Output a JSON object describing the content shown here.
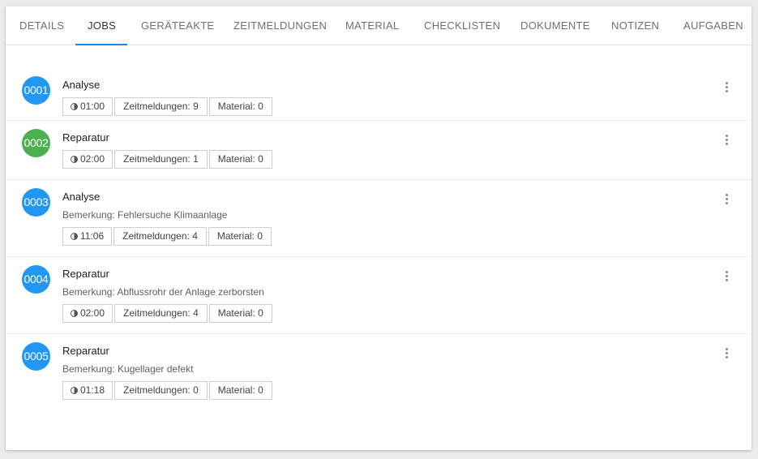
{
  "tabs": [
    {
      "label": "DETAILS",
      "active": false
    },
    {
      "label": "JOBS",
      "active": true
    },
    {
      "label": "GERÄTEAKTE",
      "active": false
    },
    {
      "label": "ZEITMELDUNGEN",
      "active": false
    },
    {
      "label": "MATERIAL",
      "active": false
    },
    {
      "label": "CHECKLISTEN",
      "active": false
    },
    {
      "label": "DOKUMENTE",
      "active": false
    },
    {
      "label": "NOTIZEN",
      "active": false
    },
    {
      "label": "AUFGABEN",
      "active": false
    }
  ],
  "colors": {
    "accent": "#1e88e5",
    "blue_badge": "#2196f3",
    "green_badge": "#4caf50"
  },
  "jobs": [
    {
      "number": "0001",
      "color": "#2196f3",
      "title": "Analyse",
      "remark": "",
      "time": "01:00",
      "zeitmeldungen": "Zeitmeldungen: 9",
      "material": "Material: 0",
      "menu_icon": "more-vert-icon"
    },
    {
      "number": "0002",
      "color": "#4caf50",
      "title": "Reparatur",
      "remark": "",
      "time": "02:00",
      "zeitmeldungen": "Zeitmeldungen: 1",
      "material": "Material: 0",
      "menu_icon": "more-vert-icon"
    },
    {
      "number": "0003",
      "color": "#2196f3",
      "title": "Analyse",
      "remark": "Bemerkung: Fehlersuche Klimaanlage",
      "time": "11:06",
      "zeitmeldungen": "Zeitmeldungen: 4",
      "material": "Material: 0",
      "menu_icon": "more-vert-icon"
    },
    {
      "number": "0004",
      "color": "#2196f3",
      "title": "Reparatur",
      "remark": "Bemerkung: Abflussrohr der Anlage zerborsten",
      "time": "02:00",
      "zeitmeldungen": "Zeitmeldungen: 4",
      "material": "Material: 0",
      "menu_icon": "more-vert-icon"
    },
    {
      "number": "0005",
      "color": "#2196f3",
      "title": "Reparatur",
      "remark": "Bemerkung: Kugellager defekt",
      "time": "01:18",
      "zeitmeldungen": "Zeitmeldungen: 0",
      "material": "Material: 0",
      "menu_icon": "more-vert-icon"
    }
  ]
}
